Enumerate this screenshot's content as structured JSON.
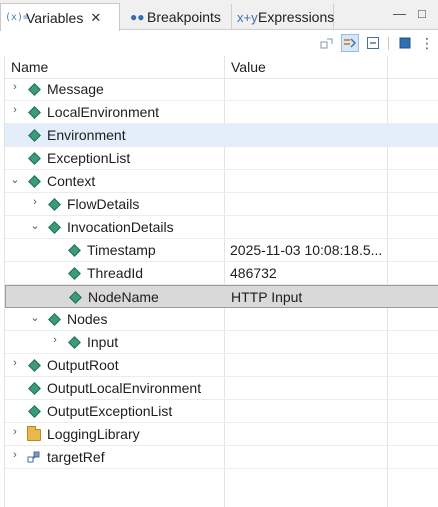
{
  "tabs": [
    {
      "label": "Variables",
      "icon": "variables-icon",
      "active": true,
      "close": "✕"
    },
    {
      "label": "Breakpoints",
      "icon": "breakpoints-icon",
      "active": false
    },
    {
      "label": "Expressions",
      "icon": "expressions-icon",
      "active": false
    }
  ],
  "tab_icons": {
    "variables": "(x)=",
    "breakpoints": "●●",
    "expressions": "x+y"
  },
  "window_controls": {
    "minimize": "—",
    "maximize": "□"
  },
  "toolbar": {
    "buttons": [
      "collapse-tree-icon",
      "show-type-names-icon",
      "collapse-all-icon",
      "maximize-view-icon",
      "view-menu-icon"
    ],
    "view_menu_glyph": "⋮"
  },
  "columns": {
    "name": "Name",
    "value": "Value"
  },
  "rows": [
    {
      "name": "Message",
      "value": "",
      "twisty": "›",
      "icon": "diamond"
    },
    {
      "name": "LocalEnvironment",
      "value": "",
      "twisty": "›",
      "icon": "diamond"
    },
    {
      "name": "Environment",
      "value": "",
      "twisty": "",
      "icon": "diamond",
      "selected": "light"
    },
    {
      "name": "ExceptionList",
      "value": "",
      "twisty": "",
      "icon": "diamond"
    },
    {
      "name": "Context",
      "value": "",
      "twisty": "⌄",
      "icon": "diamond"
    },
    {
      "name": "FlowDetails",
      "value": "",
      "twisty": "›",
      "icon": "diamond"
    },
    {
      "name": "InvocationDetails",
      "value": "",
      "twisty": "⌄",
      "icon": "diamond"
    },
    {
      "name": "Timestamp",
      "value": "2025-11-03 10:08:18.5...",
      "twisty": "",
      "icon": "diamond"
    },
    {
      "name": "ThreadId",
      "value": "486732",
      "twisty": "",
      "icon": "diamond"
    },
    {
      "name": "NodeName",
      "value": "HTTP Input",
      "twisty": "",
      "icon": "diamond",
      "selected": "gray"
    },
    {
      "name": "Nodes",
      "value": "",
      "twisty": "⌄",
      "icon": "diamond"
    },
    {
      "name": "Input",
      "value": "",
      "twisty": "›",
      "icon": "diamond"
    },
    {
      "name": "OutputRoot",
      "value": "",
      "twisty": "›",
      "icon": "diamond"
    },
    {
      "name": "OutputLocalEnvironment",
      "value": "",
      "twisty": "",
      "icon": "diamond"
    },
    {
      "name": "OutputExceptionList",
      "value": "",
      "twisty": "",
      "icon": "diamond"
    },
    {
      "name": "LoggingLibrary",
      "value": "",
      "twisty": "›",
      "icon": "folder"
    },
    {
      "name": "targetRef",
      "value": "",
      "twisty": "›",
      "icon": "reference"
    }
  ]
}
